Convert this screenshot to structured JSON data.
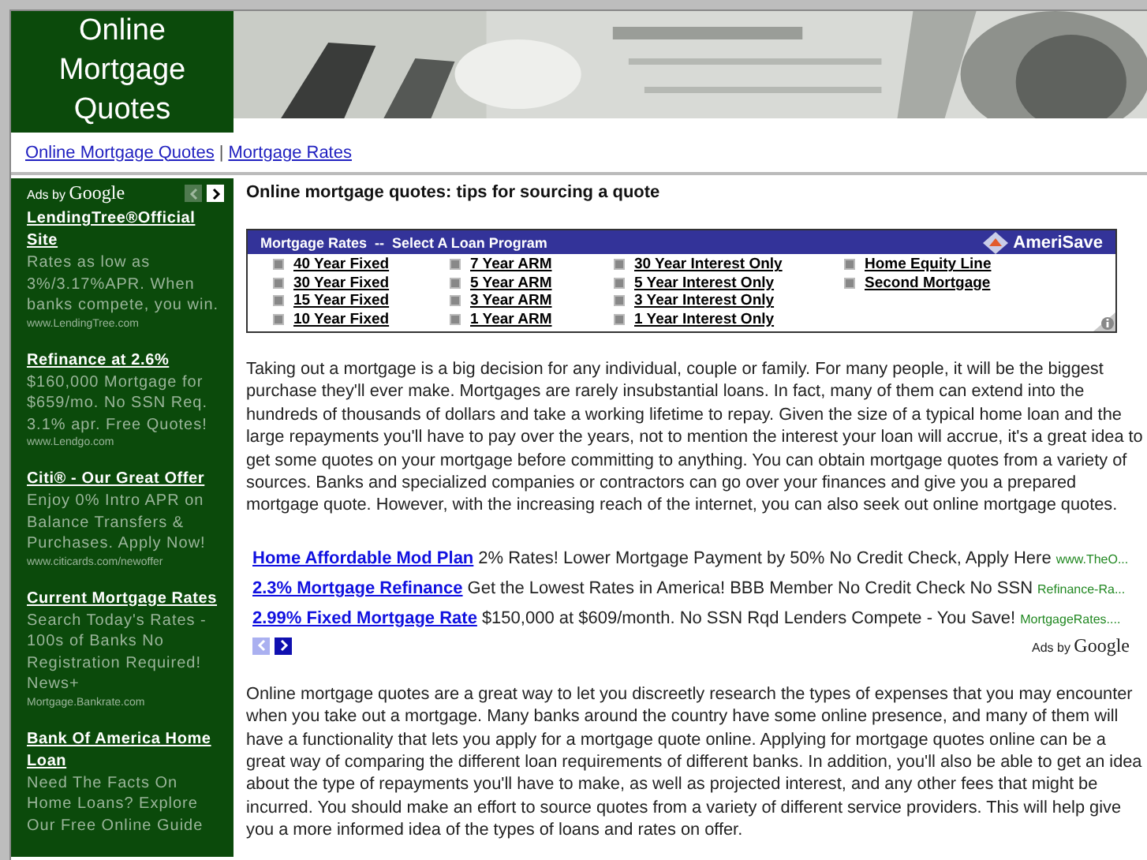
{
  "site_title": "Online Mortgage Quotes",
  "nav": [
    {
      "label": "Online Mortgage Quotes"
    },
    {
      "label": "Mortgage Rates"
    }
  ],
  "nav_separator": "|",
  "sidebar": {
    "ads_by": "Ads by",
    "ads_brand": "Google",
    "prev_enabled": false,
    "next_enabled": true,
    "ads": [
      {
        "title": "LendingTree®Official Site",
        "body": "Rates as low as 3%/3.17%APR. When banks compete, you win.",
        "url": "www.LendingTree.com"
      },
      {
        "title": "Refinance at 2.6%",
        "body": "$160,000 Mortgage for $659/mo. No SSN Req. 3.1% apr. Free Quotes!",
        "url": "www.Lendgo.com"
      },
      {
        "title": "Citi® - Our Great Offer",
        "body": "Enjoy 0% Intro APR on Balance Transfers & Purchases. Apply Now!",
        "url": "www.citicards.com/newoffer"
      },
      {
        "title": "Current Mortgage Rates",
        "body": "Search Today's Rates - 100s of Banks No Registration Required! News+",
        "url": "Mortgage.Bankrate.com"
      },
      {
        "title": "Bank Of America Home Loan",
        "body": "Need The Facts On Home Loans? Explore Our Free Online Guide"
      }
    ]
  },
  "heading": "Online mortgage quotes: tips for sourcing a quote",
  "rates_widget": {
    "title": "Mortgage Rates  --  Select A Loan Program",
    "brand": "AmeriSave",
    "columns": [
      [
        "40 Year Fixed",
        "30 Year Fixed",
        "15 Year Fixed",
        "10 Year Fixed"
      ],
      [
        "7 Year ARM",
        "5 Year ARM",
        "3 Year ARM",
        "1 Year ARM"
      ],
      [
        "30 Year Interest Only",
        "5 Year Interest Only",
        "3 Year Interest Only",
        "1 Year Interest Only"
      ],
      [
        "Home Equity Line",
        "Second Mortgage"
      ]
    ]
  },
  "paragraphs": [
    "Taking out a mortgage is a big decision for any individual, couple or family. For many people, it will be the biggest purchase they'll ever make. Mortgages are rarely insubstantial loans. In fact, many of them can extend into the hundreds of thousands of dollars and take a working lifetime to repay. Given the size of a typical home loan and the large repayments you'll have to pay over the years, not to mention the interest your loan will accrue, it's a great idea to get some quotes on your mortgage before committing to anything. You can obtain mortgage quotes from a variety of sources. Banks and specialized companies or contractors can go over your finances and give you a prepared mortgage quote. However, with the increasing reach of the internet, you can also seek out online mortgage quotes.",
    "Online mortgage quotes are a great way to let you discreetly research the types of expenses that you may encounter when you take out a mortgage. Many banks around the country have some online presence, and many of them will have a functionality that lets you apply for a mortgage quote online. Applying for mortgage quotes online can be a great way of comparing the different loan requirements of different banks. In addition, you'll also be able to get an idea about the type of repayments you'll have to make, as well as projected interest, and any other fees that might be incurred. You should make an effort to source quotes from a variety of different service providers. This will help give you a more informed idea of the types of loans and rates on offer."
  ],
  "text_ads": {
    "ads_by": "Ads by",
    "ads_brand": "Google",
    "prev_enabled": false,
    "next_enabled": true,
    "ads": [
      {
        "title": "Home Affordable Mod Plan",
        "body": "2% Rates! Lower Mortgage Payment by 50% No Credit Check, Apply Here",
        "url": "www.TheO..."
      },
      {
        "title": "2.3% Mortgage Refinance",
        "body": "Get the Lowest Rates in America! BBB Member No Credit Check No SSN",
        "url": "Refinance-Ra..."
      },
      {
        "title": "2.99% Fixed Mortgage Rate",
        "body": "$150,000 at $609/month. No SSN Rqd Lenders Compete - You Save!",
        "url": "MortgageRates...."
      }
    ]
  }
}
